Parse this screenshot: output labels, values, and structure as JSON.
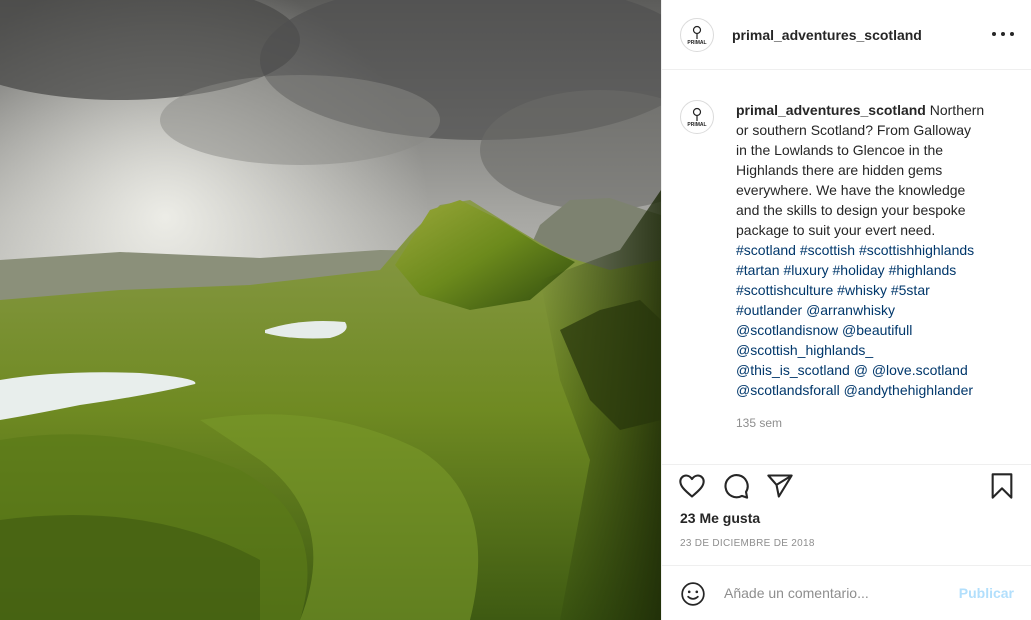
{
  "post": {
    "username": "primal_adventures_scotland",
    "caption_lines": [
      {
        "user": "primal_adventures_scotland",
        "text": " Northern"
      },
      {
        "text": "or southern Scotland? From Galloway"
      },
      {
        "text": "in the Lowlands to Glencoe in the"
      },
      {
        "text": "Highlands there are hidden gems"
      },
      {
        "text": "everywhere. We have the knowledge"
      },
      {
        "text": "and the skills to design your bespoke"
      },
      {
        "text": "package to suit your evert need."
      }
    ],
    "tag_lines": [
      [
        "#scotland",
        "#scottish",
        "#scottishhighlands"
      ],
      [
        "#tartan",
        "#luxury",
        "#holiday",
        "#highlands"
      ],
      [
        "#scottishculture",
        "#whisky",
        "#5star"
      ],
      [
        "#outlander",
        "@arranwhisky"
      ],
      [
        "@scotlandisnow",
        "@beautifull"
      ],
      [
        "@scottish_highlands_"
      ],
      [
        "@this_is_scotland",
        "@",
        "@love.scotland"
      ],
      [
        "@scotlandsforall",
        "@andythehighlander"
      ]
    ],
    "caption_time": "135 sem",
    "likes": "23 Me gusta",
    "date": "23 DE DICIEMBRE DE 2018"
  },
  "comment": {
    "placeholder": "Añade un comentario...",
    "publish_label": "Publicar"
  },
  "avatar_logo_text": "PRIMAL",
  "icons": {
    "more": "more-options-icon",
    "like": "heart-icon",
    "comment": "comment-icon",
    "share": "share-icon",
    "save": "bookmark-icon",
    "emoji": "emoji-icon"
  },
  "colors": {
    "text": "#262626",
    "secondary": "#8e8e8e",
    "link": "#00376b",
    "publish_disabled": "#b2dffc",
    "border": "#efefef"
  }
}
